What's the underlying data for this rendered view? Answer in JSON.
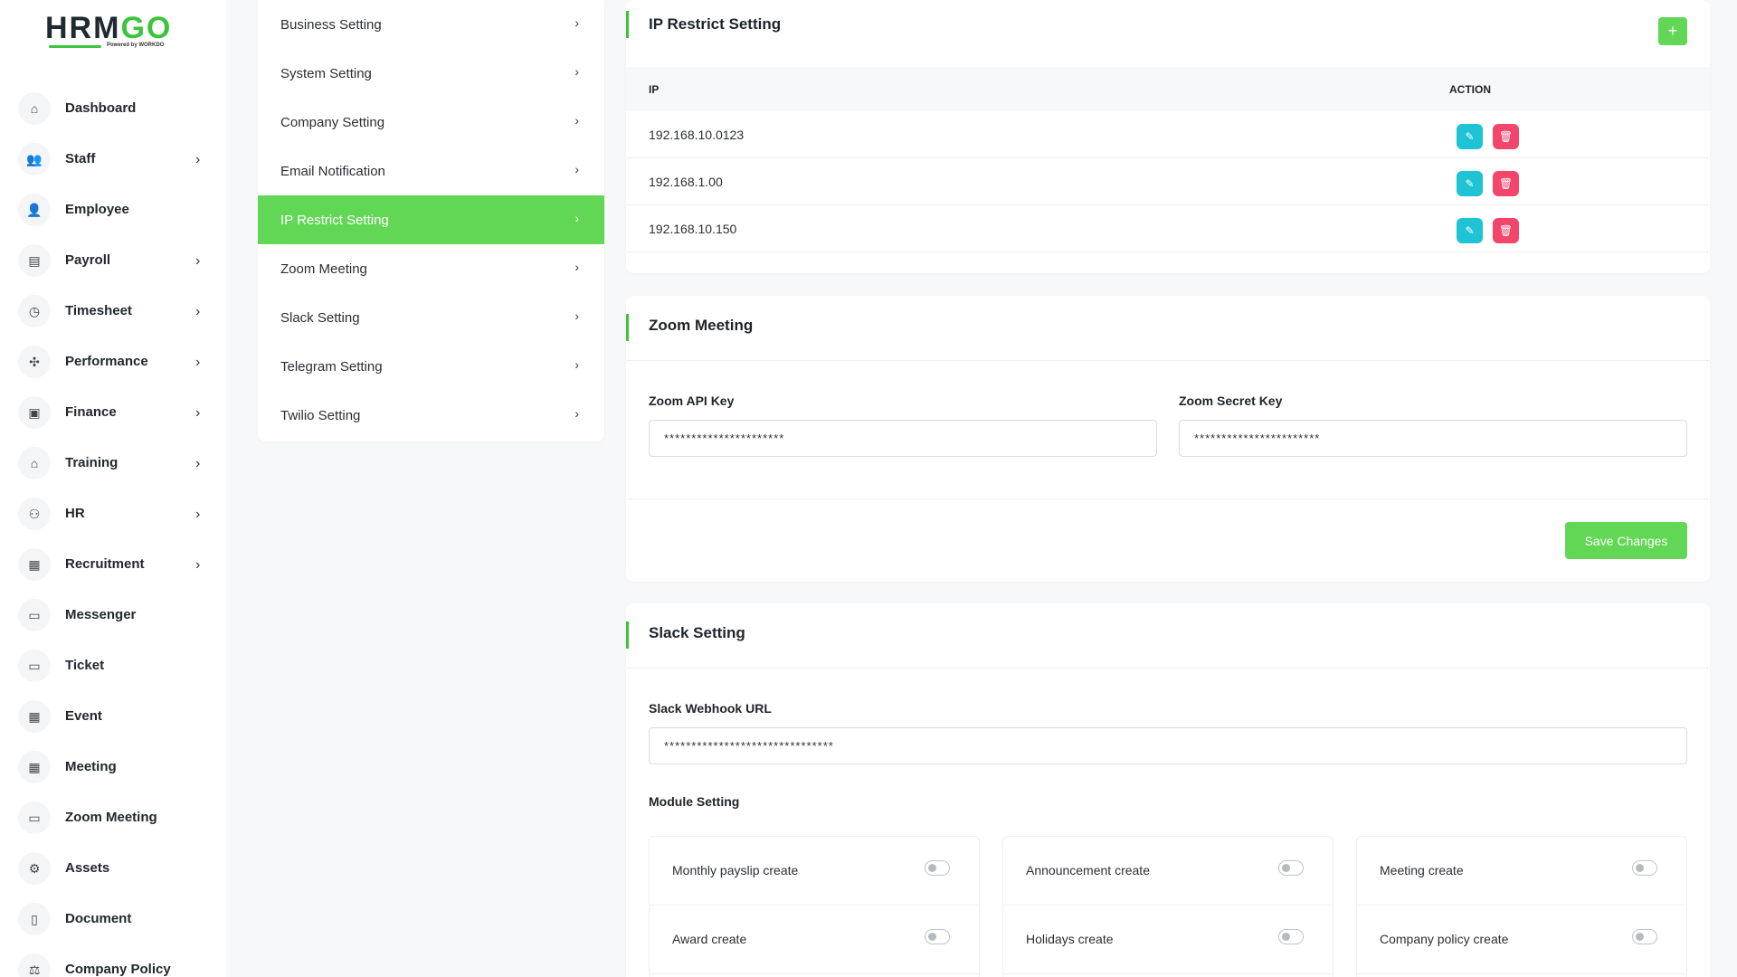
{
  "brand": {
    "logo_text_a": "HRM",
    "logo_text_b": "GO",
    "logo_sub": "Powered by WORKDO",
    "accent": "#62d655"
  },
  "sidebar": {
    "items": [
      {
        "label": "Dashboard",
        "icon": "home-icon",
        "chevron": false
      },
      {
        "label": "Staff",
        "icon": "users-icon",
        "chevron": true
      },
      {
        "label": "Employee",
        "icon": "user-icon",
        "chevron": false
      },
      {
        "label": "Payroll",
        "icon": "receipt-icon",
        "chevron": true
      },
      {
        "label": "Timesheet",
        "icon": "clock-icon",
        "chevron": true
      },
      {
        "label": "Performance",
        "icon": "performance-icon",
        "chevron": true
      },
      {
        "label": "Finance",
        "icon": "wallet-icon",
        "chevron": true
      },
      {
        "label": "Training",
        "icon": "graduation-icon",
        "chevron": true
      },
      {
        "label": "HR",
        "icon": "user-plus-icon",
        "chevron": true
      },
      {
        "label": "Recruitment",
        "icon": "clipboard-icon",
        "chevron": true
      },
      {
        "label": "Messenger",
        "icon": "video-icon",
        "chevron": false
      },
      {
        "label": "Ticket",
        "icon": "ticket-icon",
        "chevron": false
      },
      {
        "label": "Event",
        "icon": "calendar-icon",
        "chevron": false
      },
      {
        "label": "Meeting",
        "icon": "calendar-time-icon",
        "chevron": false
      },
      {
        "label": "Zoom Meeting",
        "icon": "video-icon",
        "chevron": false
      },
      {
        "label": "Assets",
        "icon": "gear-icon",
        "chevron": false
      },
      {
        "label": "Document",
        "icon": "document-icon",
        "chevron": false
      },
      {
        "label": "Company Policy",
        "icon": "policy-icon",
        "chevron": false
      }
    ]
  },
  "submenu": {
    "items": [
      {
        "label": "Business Setting"
      },
      {
        "label": "System Setting"
      },
      {
        "label": "Company Setting"
      },
      {
        "label": "Email Notification"
      },
      {
        "label": "IP Restrict Setting",
        "active": true
      },
      {
        "label": "Zoom Meeting"
      },
      {
        "label": "Slack Setting"
      },
      {
        "label": "Telegram Setting"
      },
      {
        "label": "Twilio Setting"
      }
    ]
  },
  "ip_restrict": {
    "title": "IP Restrict Setting",
    "add_label": "+",
    "col_ip": "IP",
    "col_action": "ACTION",
    "rows": [
      "192.168.10.0123",
      "192.168.1.00",
      "192.168.10.150"
    ]
  },
  "zoom": {
    "title": "Zoom Meeting",
    "api_key_label": "Zoom API Key",
    "api_key_value": "**********************",
    "secret_key_label": "Zoom Secret Key",
    "secret_key_value": "***********************",
    "save_label": "Save Changes"
  },
  "slack": {
    "title": "Slack Setting",
    "webhook_label": "Slack Webhook URL",
    "webhook_value": "*******************************",
    "module_label": "Module Setting",
    "modules": [
      [
        "Monthly payslip create",
        "Award create"
      ],
      [
        "Announcement create",
        "Holidays create"
      ],
      [
        "Meeting create",
        "Company policy create"
      ]
    ]
  }
}
